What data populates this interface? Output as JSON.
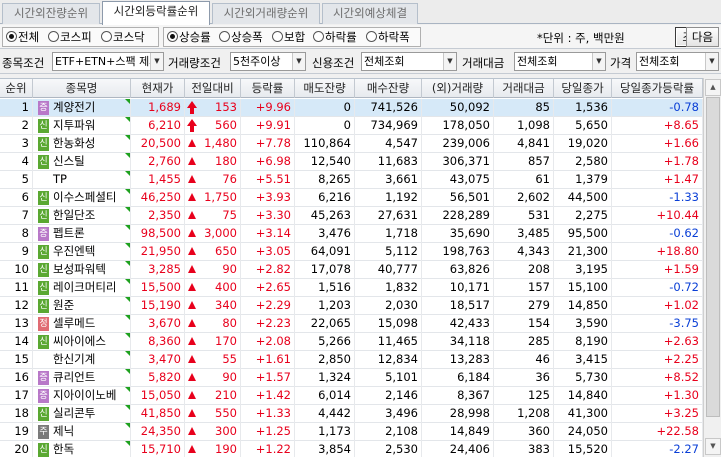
{
  "tabs": [
    "시간외잔량순위",
    "시간외등락률순위",
    "시간외거래량순위",
    "시간외예상체결"
  ],
  "market_options": [
    {
      "label": "전체",
      "selected": true
    },
    {
      "label": "코스피",
      "selected": false
    },
    {
      "label": "코스닥",
      "selected": false
    }
  ],
  "sort_options": [
    {
      "label": "상승률",
      "selected": true
    },
    {
      "label": "상승폭",
      "selected": false
    },
    {
      "label": "보합",
      "selected": false
    },
    {
      "label": "하락률",
      "selected": false
    },
    {
      "label": "하락폭",
      "selected": false
    }
  ],
  "unit_text": "*단위 : 주, 백만원",
  "buttons": {
    "search": "조회",
    "next": "다음"
  },
  "filters": {
    "item_label": "종목조건",
    "item_value": "ETF+ETN+스팩 제외",
    "volume_label": "거래량조건",
    "volume_value": "5천주이상",
    "credit_label": "신용조건",
    "credit_value": "전체조회",
    "amount_label": "거래대금",
    "amount_value": "전체조회",
    "price_label": "가격",
    "price_value": "전체조회"
  },
  "columns": [
    "순위",
    "종목명",
    "현재가",
    "전일대비",
    "등락률",
    "매도잔량",
    "매수잔량",
    "(외)거래량",
    "거래대금",
    "당일종가",
    "당일종가등락률"
  ],
  "rows": [
    {
      "rank": "1",
      "badge": "증",
      "badge_color": "p",
      "name": "계양전기",
      "price": "1,689",
      "change_icon": "limit-up",
      "change": "153",
      "rate": "+9.96",
      "ask": "0",
      "bid": "741,526",
      "volume": "50,092",
      "amount": "85",
      "close": "1,536",
      "close_rate": "-0.78",
      "close_dir": "dn",
      "selected": true
    },
    {
      "rank": "2",
      "badge": "신",
      "badge_color": "g",
      "name": "지투파워",
      "price": "6,210",
      "change_icon": "limit-up",
      "change": "560",
      "rate": "+9.91",
      "ask": "0",
      "bid": "734,969",
      "volume": "178,050",
      "amount": "1,098",
      "close": "5,650",
      "close_rate": "+8.65",
      "close_dir": "up"
    },
    {
      "rank": "3",
      "badge": "신",
      "badge_color": "g",
      "name": "한농화성",
      "price": "20,500",
      "change_icon": "up",
      "change": "1,480",
      "rate": "+7.78",
      "ask": "110,864",
      "bid": "4,547",
      "volume": "239,006",
      "amount": "4,841",
      "close": "19,020",
      "close_rate": "+1.66",
      "close_dir": "up"
    },
    {
      "rank": "4",
      "badge": "신",
      "badge_color": "g",
      "name": "신스틸",
      "price": "2,760",
      "change_icon": "up",
      "change": "180",
      "rate": "+6.98",
      "ask": "12,540",
      "bid": "11,683",
      "volume": "306,371",
      "amount": "857",
      "close": "2,580",
      "close_rate": "+1.78",
      "close_dir": "up"
    },
    {
      "rank": "5",
      "badge": "",
      "badge_color": "",
      "name": "TP",
      "price": "1,455",
      "change_icon": "up",
      "change": "76",
      "rate": "+5.51",
      "ask": "8,265",
      "bid": "3,661",
      "volume": "43,075",
      "amount": "61",
      "close": "1,379",
      "close_rate": "+1.47",
      "close_dir": "up"
    },
    {
      "rank": "6",
      "badge": "신",
      "badge_color": "g",
      "name": "이수스페셜티",
      "price": "46,250",
      "change_icon": "up",
      "change": "1,750",
      "rate": "+3.93",
      "ask": "6,216",
      "bid": "1,192",
      "volume": "56,501",
      "amount": "2,602",
      "close": "44,500",
      "close_rate": "-1.33",
      "close_dir": "dn"
    },
    {
      "rank": "7",
      "badge": "신",
      "badge_color": "g",
      "name": "한일단조",
      "price": "2,350",
      "change_icon": "up",
      "change": "75",
      "rate": "+3.30",
      "ask": "45,263",
      "bid": "27,631",
      "volume": "228,289",
      "amount": "531",
      "close": "2,275",
      "close_rate": "+10.44",
      "close_dir": "up"
    },
    {
      "rank": "8",
      "badge": "증",
      "badge_color": "p",
      "name": "펩트론",
      "price": "98,500",
      "change_icon": "up",
      "change": "3,000",
      "rate": "+3.14",
      "ask": "3,476",
      "bid": "1,718",
      "volume": "35,690",
      "amount": "3,485",
      "close": "95,500",
      "close_rate": "-0.62",
      "close_dir": "dn"
    },
    {
      "rank": "9",
      "badge": "신",
      "badge_color": "g",
      "name": "우진엔텍",
      "price": "21,950",
      "change_icon": "up",
      "change": "650",
      "rate": "+3.05",
      "ask": "64,091",
      "bid": "5,112",
      "volume": "198,763",
      "amount": "4,343",
      "close": "21,300",
      "close_rate": "+18.80",
      "close_dir": "up"
    },
    {
      "rank": "10",
      "badge": "신",
      "badge_color": "g",
      "name": "보성파워텍",
      "price": "3,285",
      "change_icon": "up",
      "change": "90",
      "rate": "+2.82",
      "ask": "17,078",
      "bid": "40,777",
      "volume": "63,826",
      "amount": "208",
      "close": "3,195",
      "close_rate": "+1.59",
      "close_dir": "up"
    },
    {
      "rank": "11",
      "badge": "신",
      "badge_color": "g",
      "name": "레이크머티리",
      "price": "15,500",
      "change_icon": "up",
      "change": "400",
      "rate": "+2.65",
      "ask": "1,516",
      "bid": "1,832",
      "volume": "10,171",
      "amount": "157",
      "close": "15,100",
      "close_rate": "-0.72",
      "close_dir": "dn"
    },
    {
      "rank": "12",
      "badge": "신",
      "badge_color": "g",
      "name": "원준",
      "price": "15,190",
      "change_icon": "up",
      "change": "340",
      "rate": "+2.29",
      "ask": "1,203",
      "bid": "2,030",
      "volume": "18,517",
      "amount": "279",
      "close": "14,850",
      "close_rate": "+1.02",
      "close_dir": "up"
    },
    {
      "rank": "13",
      "badge": "정",
      "badge_color": "r2",
      "name": "셀루메드",
      "price": "3,670",
      "change_icon": "up",
      "change": "80",
      "rate": "+2.23",
      "ask": "22,065",
      "bid": "15,098",
      "volume": "42,433",
      "amount": "154",
      "close": "3,590",
      "close_rate": "-3.75",
      "close_dir": "dn"
    },
    {
      "rank": "14",
      "badge": "신",
      "badge_color": "g",
      "name": "씨아이에스",
      "price": "8,360",
      "change_icon": "up",
      "change": "170",
      "rate": "+2.08",
      "ask": "5,266",
      "bid": "11,465",
      "volume": "34,118",
      "amount": "285",
      "close": "8,190",
      "close_rate": "+2.63",
      "close_dir": "up"
    },
    {
      "rank": "15",
      "badge": "",
      "badge_color": "",
      "name": "한신기계",
      "price": "3,470",
      "change_icon": "up",
      "change": "55",
      "rate": "+1.61",
      "ask": "2,850",
      "bid": "12,834",
      "volume": "13,283",
      "amount": "46",
      "close": "3,415",
      "close_rate": "+2.25",
      "close_dir": "up"
    },
    {
      "rank": "16",
      "badge": "증",
      "badge_color": "p",
      "name": "큐리언트",
      "price": "5,820",
      "change_icon": "up",
      "change": "90",
      "rate": "+1.57",
      "ask": "1,324",
      "bid": "5,101",
      "volume": "6,184",
      "amount": "36",
      "close": "5,730",
      "close_rate": "+8.52",
      "close_dir": "up"
    },
    {
      "rank": "17",
      "badge": "증",
      "badge_color": "p",
      "name": "지아이이노베",
      "price": "15,050",
      "change_icon": "up",
      "change": "210",
      "rate": "+1.42",
      "ask": "6,014",
      "bid": "2,146",
      "volume": "8,367",
      "amount": "125",
      "close": "14,840",
      "close_rate": "+1.30",
      "close_dir": "up"
    },
    {
      "rank": "18",
      "badge": "신",
      "badge_color": "g",
      "name": "실리콘투",
      "price": "41,850",
      "change_icon": "up",
      "change": "550",
      "rate": "+1.33",
      "ask": "4,442",
      "bid": "3,496",
      "volume": "28,998",
      "amount": "1,208",
      "close": "41,300",
      "close_rate": "+3.25",
      "close_dir": "up"
    },
    {
      "rank": "19",
      "badge": "주",
      "badge_color": "k",
      "name": "제닉",
      "price": "24,350",
      "change_icon": "up",
      "change": "300",
      "rate": "+1.25",
      "ask": "1,173",
      "bid": "2,108",
      "volume": "14,849",
      "amount": "360",
      "close": "24,050",
      "close_rate": "+22.58",
      "close_dir": "up"
    },
    {
      "rank": "20",
      "badge": "신",
      "badge_color": "g",
      "name": "한독",
      "price": "15,710",
      "change_icon": "up",
      "change": "190",
      "rate": "+1.22",
      "ask": "3,854",
      "bid": "2,530",
      "volume": "24,406",
      "amount": "383",
      "close": "15,520",
      "close_rate": "-2.27",
      "close_dir": "dn"
    }
  ]
}
